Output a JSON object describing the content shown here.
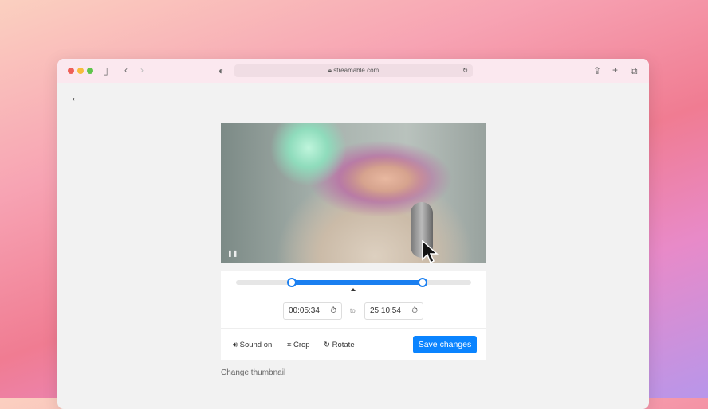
{
  "browser": {
    "url": "streamable.com"
  },
  "editor": {
    "start_time": "00:05:34",
    "to_label": "to",
    "end_time": "25:10:54",
    "trim_start_fraction": 0.24,
    "trim_end_fraction": 0.8,
    "tools": {
      "sound": "Sound on",
      "crop": "Crop",
      "rotate": "Rotate"
    },
    "save_label": "Save changes",
    "change_thumbnail": "Change thumbnail"
  },
  "colors": {
    "accent": "#0a84ff"
  }
}
